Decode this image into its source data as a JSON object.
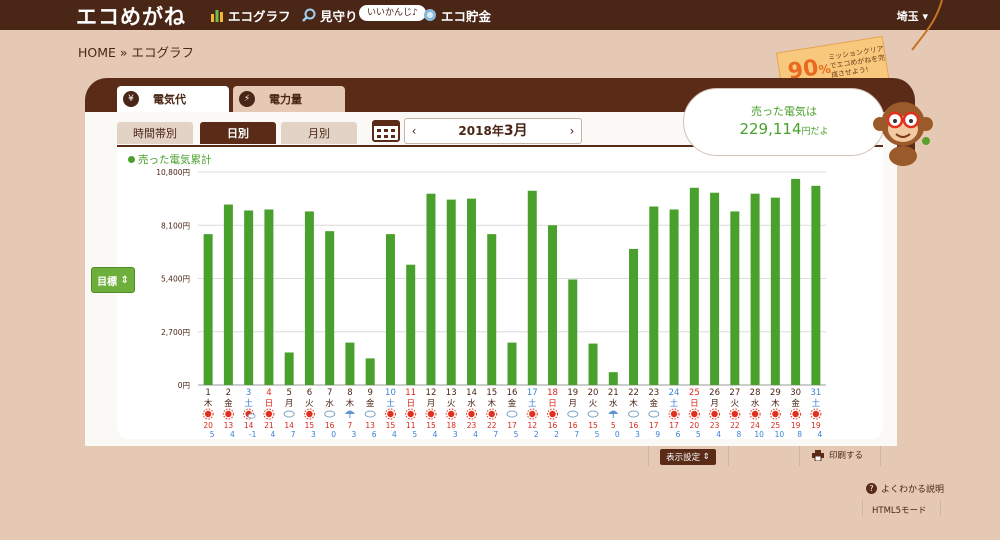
{
  "header": {
    "logo": "エコめがね",
    "nav": [
      {
        "label": "エコグラフ",
        "icon": "bar-graph-icon"
      },
      {
        "label": "見守り",
        "icon": "magnifier-icon"
      },
      {
        "label": "エコ貯金",
        "icon": "piggy-coin-icon"
      }
    ],
    "nav_bubble": "いいかんじ♪",
    "prefecture": "埼玉"
  },
  "breadcrumb": {
    "home": "HOME",
    "sep": "»",
    "current": "エコグラフ"
  },
  "mission_tag": {
    "percent": "90",
    "unit": "%",
    "message": "ミッションクリアでエコめがねを完成させよう!"
  },
  "main_tabs": [
    {
      "label": "電気代",
      "icon": "yen-icon",
      "active": true
    },
    {
      "label": "電力量",
      "icon": "lightning-icon",
      "active": false
    }
  ],
  "sub_tabs": [
    {
      "label": "時間帯別",
      "active": false
    },
    {
      "label": "日別",
      "active": true
    },
    {
      "label": "月別",
      "active": false
    }
  ],
  "date_nav": {
    "prev": "‹",
    "year": "2018年",
    "month": "3月",
    "next": "›"
  },
  "sold_bubble": {
    "line1": "売った電気は",
    "amount": "229,114",
    "suffix": "円だよ"
  },
  "goal_button": "目標",
  "footer": {
    "display_settings": "表示設定",
    "print": "印刷する",
    "help": "よくわかる説明",
    "html5": "HTML5モード"
  },
  "colors": {
    "brand_brown": "#4a2616",
    "bar_green": "#4aa02c",
    "background": "#e6c9b5",
    "weekend_red": "#d9261c",
    "saturday_blue": "#3a7fd8"
  },
  "chart_data": {
    "type": "bar",
    "legend": "売った電気累計",
    "yticks": [
      "10,800円",
      "8,100円",
      "5,400円",
      "2,700円",
      "0円"
    ],
    "ylim": [
      0,
      10800
    ],
    "grid": true,
    "x": [
      1,
      2,
      3,
      4,
      5,
      6,
      7,
      8,
      9,
      10,
      11,
      12,
      13,
      14,
      15,
      16,
      17,
      18,
      19,
      20,
      21,
      22,
      23,
      24,
      25,
      26,
      27,
      28,
      29,
      30,
      31
    ],
    "weekday": [
      "木",
      "金",
      "土",
      "日",
      "月",
      "火",
      "水",
      "木",
      "金",
      "土",
      "日",
      "月",
      "火",
      "水",
      "木",
      "金",
      "土",
      "日",
      "月",
      "火",
      "水",
      "木",
      "金",
      "土",
      "日",
      "月",
      "火",
      "水",
      "木",
      "金",
      "土"
    ],
    "values": [
      7650,
      9150,
      8850,
      8900,
      1650,
      8800,
      7800,
      2150,
      1350,
      7650,
      6100,
      9700,
      9400,
      9450,
      7650,
      2150,
      9850,
      8100,
      5350,
      2100,
      650,
      6900,
      9050,
      8900,
      10000,
      9750,
      8800,
      9700,
      9500,
      10450,
      10100
    ],
    "weather": [
      "sun",
      "sun",
      "sun-cloud",
      "sun",
      "cloud",
      "sun",
      "cloud",
      "rain",
      "cloud",
      "sun",
      "sun",
      "sun",
      "sun",
      "sun",
      "sun",
      "cloud",
      "sun",
      "sun",
      "cloud",
      "cloud",
      "rain",
      "cloud",
      "cloud",
      "sun",
      "sun",
      "sun",
      "sun",
      "sun",
      "sun",
      "sun",
      "sun"
    ],
    "temp_high": [
      "20",
      "13",
      "14",
      "21",
      "14",
      "15",
      "16",
      "7",
      "13",
      "15",
      "11",
      "15",
      "18",
      "23",
      "22",
      "17",
      "12",
      "16",
      "16",
      "15",
      "5",
      "16",
      "17",
      "17",
      "20",
      "23",
      "22",
      "24",
      "25",
      "19",
      "19"
    ],
    "temp_low": [
      "5",
      "4",
      "-1",
      "4",
      "7",
      "3",
      "0",
      "3",
      "6",
      "4",
      "5",
      "4",
      "3",
      "4",
      "7",
      "5",
      "2",
      "2",
      "7",
      "5",
      "0",
      "3",
      "9",
      "6",
      "5",
      "4",
      "8",
      "10",
      "10",
      "8",
      "4"
    ]
  }
}
